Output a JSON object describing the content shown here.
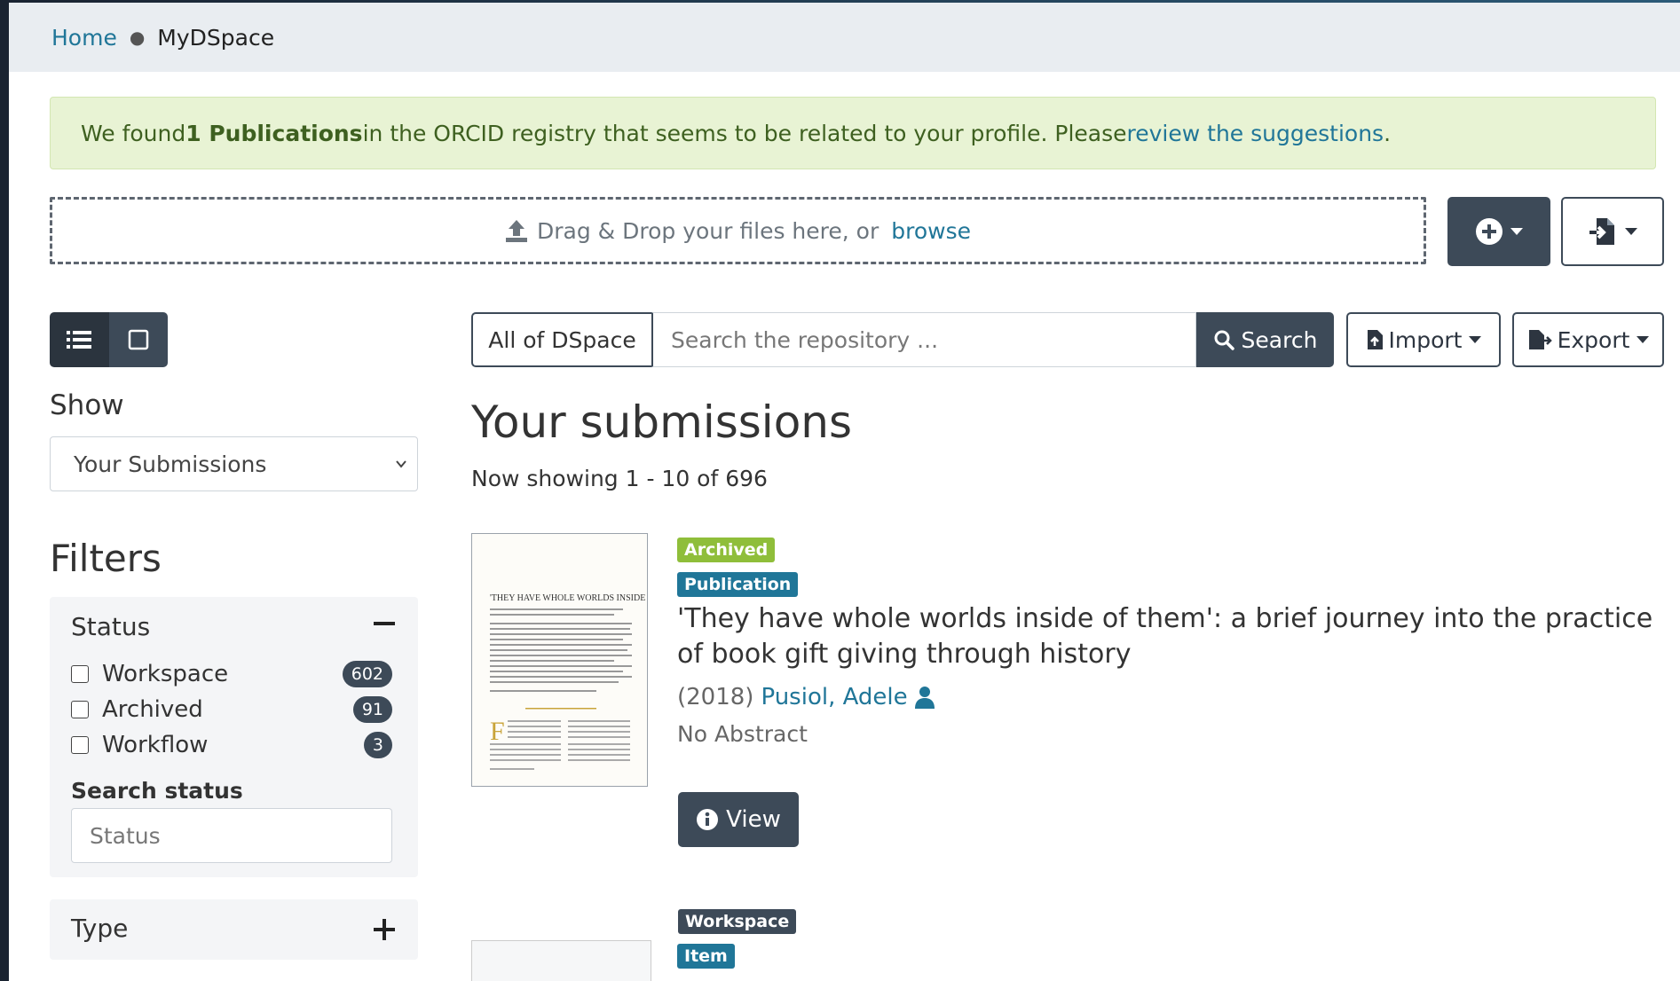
{
  "breadcrumb": {
    "home": "Home",
    "current": "MyDSpace"
  },
  "alert": {
    "pre": "We found ",
    "bold": "1 Publications",
    "mid": " in the ORCID registry that seems to be related to your profile. Please ",
    "link": "review the suggestions",
    "post": "."
  },
  "dropzone": {
    "text": "Drag & Drop your files here, or",
    "browse": "browse"
  },
  "sidebar": {
    "show_label": "Show",
    "show_value": "Your Submissions",
    "filters_title": "Filters",
    "status_facet": {
      "title": "Status",
      "options": [
        {
          "label": "Workspace",
          "count": "602"
        },
        {
          "label": "Archived",
          "count": "91"
        },
        {
          "label": "Workflow",
          "count": "3"
        }
      ],
      "search_label": "Search status",
      "search_placeholder": "Status"
    },
    "type_facet": {
      "title": "Type"
    }
  },
  "search": {
    "scope": "All of DSpace",
    "placeholder": "Search the repository ...",
    "button": "Search",
    "import": "Import",
    "export": "Export"
  },
  "main": {
    "title": "Your submissions",
    "showing": "Now showing 1 - 10 of 696",
    "results": [
      {
        "badges": [
          "Archived",
          "Publication"
        ],
        "title": "'They have whole worlds inside of them': a brief journey into the practice of book gift giving through history",
        "year": "(2018)",
        "author": "Pusiol, Adele",
        "abstract": "No Abstract",
        "view": "View",
        "thumb_heading": "'THEY HAVE WHOLE WORLDS INSIDE OF THEM'"
      },
      {
        "badges": [
          "Workspace",
          "Item"
        ]
      }
    ]
  },
  "colors": {
    "primary_dark": "#3d4a58",
    "link": "#207698",
    "archived": "#8fbe3a",
    "alert_bg": "#e8f3d4"
  }
}
